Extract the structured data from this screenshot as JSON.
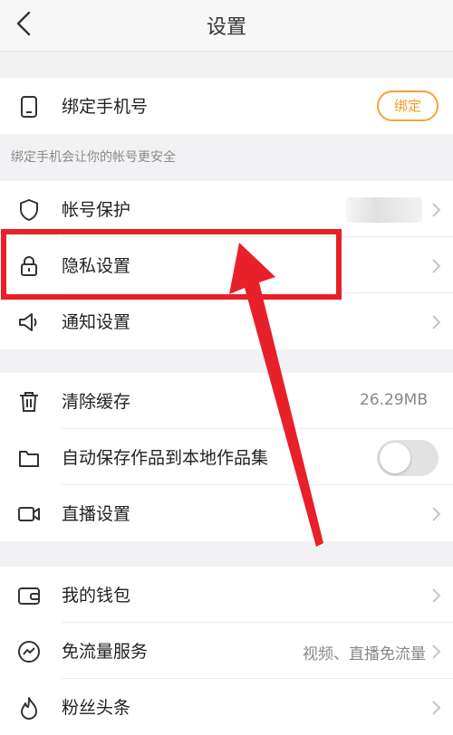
{
  "header": {
    "title": "设置",
    "back_icon": "chevron-left-icon"
  },
  "phone": {
    "label": "绑定手机号",
    "button": "绑定",
    "hint": "绑定手机会让你的帐号更安全"
  },
  "security": {
    "items": [
      {
        "label": "帐号保护",
        "icon": "shield-icon"
      },
      {
        "label": "隐私设置",
        "icon": "lock-icon"
      },
      {
        "label": "通知设置",
        "icon": "speaker-icon"
      }
    ]
  },
  "storage": {
    "items": [
      {
        "label": "清除缓存",
        "value": "26.29MB",
        "icon": "trash-icon"
      },
      {
        "label": "自动保存作品到本地作品集",
        "icon": "folder-icon",
        "toggle_on": false
      },
      {
        "label": "直播设置",
        "icon": "video-camera-icon"
      }
    ]
  },
  "services": {
    "items": [
      {
        "label": "我的钱包",
        "icon": "wallet-icon"
      },
      {
        "label": "免流量服务",
        "value": "视频、直播免流量",
        "icon": "trend-icon"
      },
      {
        "label": "粉丝头条",
        "icon": "flame-icon"
      }
    ]
  },
  "annotation": {
    "color": "#e8202a"
  },
  "colors": {
    "accent": "#f59a23"
  }
}
